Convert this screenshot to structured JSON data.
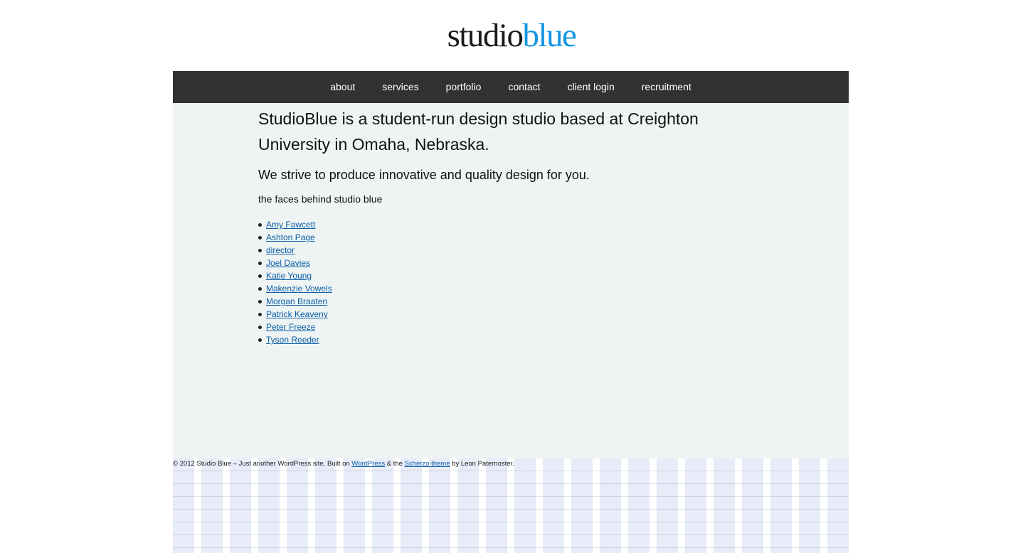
{
  "logo": {
    "part_a": "studio",
    "part_b": "blue",
    "accent_color": "#1596e2"
  },
  "nav": {
    "items": [
      "about",
      "services",
      "portfolio",
      "contact",
      "client login",
      "recruitment"
    ]
  },
  "main": {
    "headline": "StudioBlue is a student-run design studio based at Creighton University in Omaha, Nebraska.",
    "subhead": "We strive to produce innovative and quality design for you.",
    "faces_label": "the faces behind studio blue",
    "people": [
      "Amy Fawcett",
      "Ashton Page",
      "director",
      "Joel Davies",
      "Katie Young",
      "Makenzie Vowels",
      "Morgan Braaten",
      "Patrick Keaveny",
      "Peter Freeze",
      "Tyson Reeder"
    ]
  },
  "footer": {
    "prefix": "© 2012 Studio Blue – Just another WordPress site. Built on ",
    "wordpress_link": "WordPress",
    "middle": " & the ",
    "theme_link": "Scherzo theme",
    "suffix": " by Leon Paternoster."
  },
  "colors": {
    "nav_bg": "#333231",
    "content_bg": "#eef4f3",
    "link": "#0b5ea8"
  }
}
